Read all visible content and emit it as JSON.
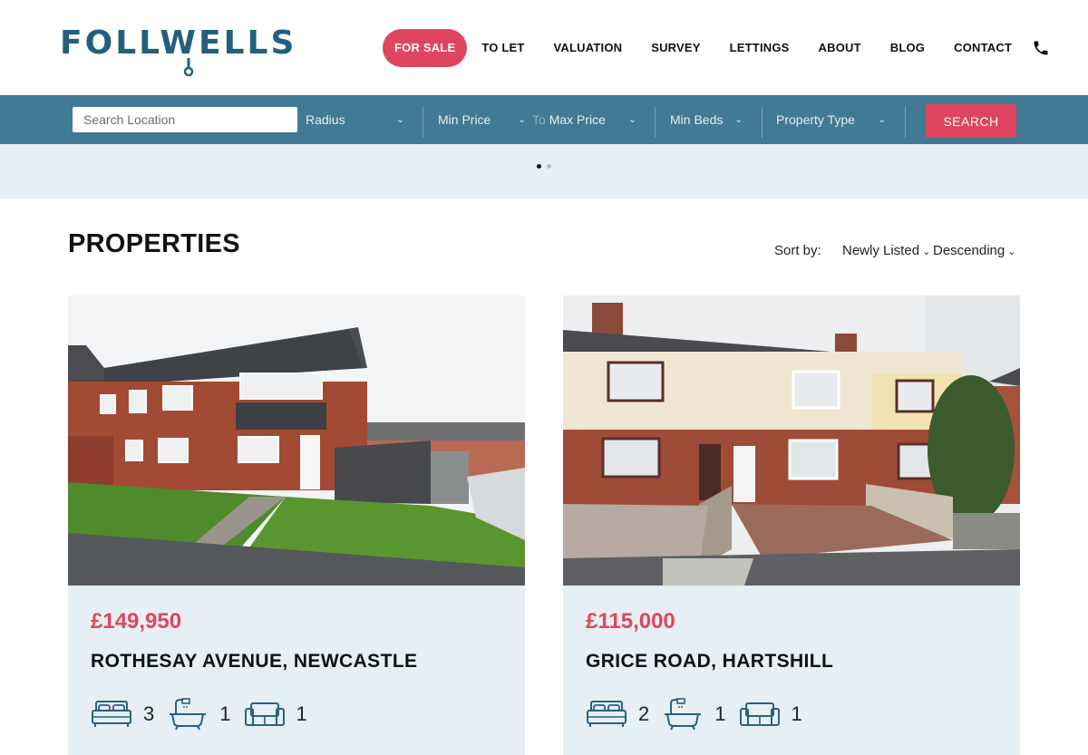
{
  "brand": {
    "logo_text": "FOLLWELLS",
    "accent": "#e0455f",
    "primary": "#417a93",
    "logo_color": "#24607e"
  },
  "nav": {
    "items": [
      {
        "label": "FOR SALE",
        "active": true
      },
      {
        "label": "TO LET"
      },
      {
        "label": "VALUATION"
      },
      {
        "label": "SURVEY"
      },
      {
        "label": "LETTINGS"
      },
      {
        "label": "ABOUT"
      },
      {
        "label": "BLOG"
      },
      {
        "label": "CONTACT"
      }
    ],
    "phone_icon": "phone-icon"
  },
  "search": {
    "location_placeholder": "Search Location",
    "radius": "Radius",
    "min_price": "Min Price",
    "to": "To",
    "max_price": "Max Price",
    "min_beds": "Min Beds",
    "property_type": "Property Type",
    "button": "SEARCH"
  },
  "page": {
    "title": "PROPERTIES",
    "sort_label": "Sort by:",
    "sort_field": "Newly Listed",
    "sort_order": "Descending"
  },
  "listings": [
    {
      "price": "£149,950",
      "address": "ROTHESAY AVENUE, NEWCASTLE",
      "beds": "3",
      "baths": "1",
      "receptions": "1"
    },
    {
      "price": "£115,000",
      "address": "GRICE ROAD, HARTSHILL",
      "beds": "2",
      "baths": "1",
      "receptions": "1"
    }
  ]
}
